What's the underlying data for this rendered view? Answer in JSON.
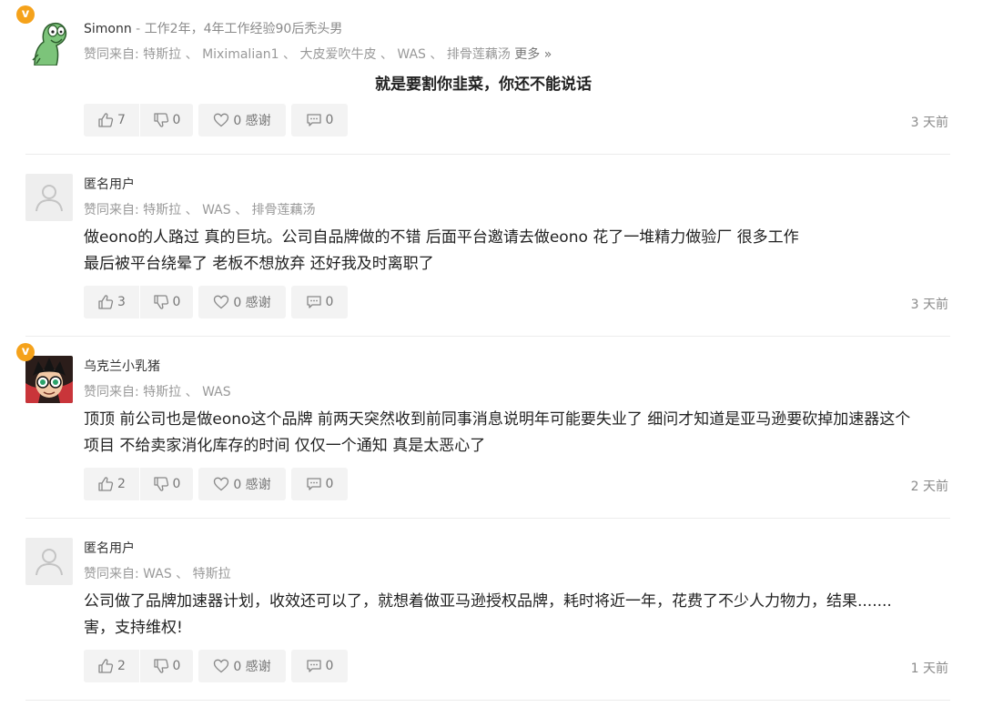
{
  "comments": [
    {
      "verified": true,
      "name": "Simonn",
      "separator": " - ",
      "bio": "工作2年，4年工作经验90后秃头男",
      "agree_prefix": "赞同来自: ",
      "agree_users": "特斯拉 、 Miximalian1 、 大皮爱吹牛皮 、 WAS 、 排骨莲藕汤",
      "agree_more": " 更多 »",
      "body": "就是要割你韭菜，你还不能说话",
      "likes": "7",
      "dislikes": "0",
      "thanks": "0 感谢",
      "replies": "0",
      "time": "3 天前"
    },
    {
      "verified": false,
      "name": "匿名用户",
      "agree_prefix": "赞同来自: ",
      "agree_users": "特斯拉 、 WAS 、 排骨莲藕汤",
      "body_line1": "做eono的人路过 真的巨坑。公司自品牌做的不错 后面平台邀请去做eono 花了一堆精力做验厂 很多工作",
      "body_line2": "最后被平台绕晕了 老板不想放弃 还好我及时离职了",
      "likes": "3",
      "dislikes": "0",
      "thanks": "0 感谢",
      "replies": "0",
      "time": "3 天前"
    },
    {
      "verified": true,
      "name": "乌克兰小乳猪",
      "agree_prefix": "赞同来自: ",
      "agree_users": "特斯拉 、 WAS",
      "body_line1": "顶顶 前公司也是做eono这个品牌 前两天突然收到前同事消息说明年可能要失业了 细问才知道是亚马逊要砍掉加速器这个",
      "body_line2": "项目 不给卖家消化库存的时间 仅仅一个通知 真是太恶心了",
      "likes": "2",
      "dislikes": "0",
      "thanks": "0 感谢",
      "replies": "0",
      "time": "2 天前"
    },
    {
      "verified": false,
      "name": "匿名用户",
      "agree_prefix": "赞同来自: ",
      "agree_users": "WAS 、 特斯拉",
      "body_line1": "公司做了品牌加速器计划，收效还可以了，就想着做亚马逊授权品牌，耗时将近一年，花费了不少人力物力，结果.......",
      "body_line2": "害，支持维权!",
      "likes": "2",
      "dislikes": "0",
      "thanks": "0 感谢",
      "replies": "0",
      "time": "1 天前"
    }
  ],
  "icons": {
    "verified": "v-badge-icon",
    "like": "thumbs-up-icon",
    "dislike": "thumbs-down-icon",
    "thanks": "heart-icon",
    "reply": "comment-icon",
    "anon": "user-silhouette-icon"
  },
  "colors": {
    "badge": "#f5a21b",
    "button_bg": "#f3f3f3",
    "muted_text": "#8a8a8a"
  }
}
